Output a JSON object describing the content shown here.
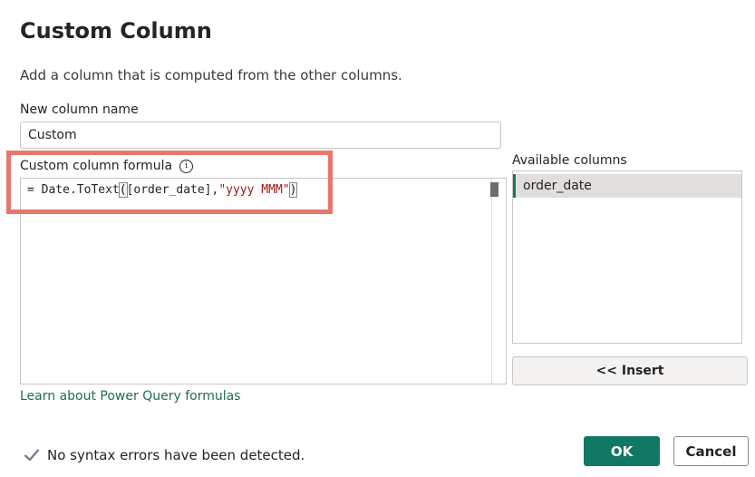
{
  "dialog": {
    "title": "Custom Column",
    "description": "Add a column that is computed from the other columns."
  },
  "name_field": {
    "label": "New column name",
    "value": "Custom"
  },
  "formula": {
    "label": "Custom column formula",
    "info_icon": "info-icon",
    "prefix": "= Date.ToText",
    "open_paren": "(",
    "column_ref": "[order_date],",
    "string_literal": "\"yyyy MMM\"",
    "close_paren": ")"
  },
  "available_columns": {
    "label": "Available columns",
    "items": [
      "order_date"
    ],
    "selected": "order_date"
  },
  "buttons": {
    "insert": "<< Insert",
    "ok": "OK",
    "cancel": "Cancel"
  },
  "links": {
    "learn": "Learn about Power Query formulas"
  },
  "status": {
    "text": "No syntax errors have been detected.",
    "icon": "checkmark-icon"
  },
  "colors": {
    "accent": "#117865",
    "highlight_box": "#e8776a",
    "string": "#a31515"
  }
}
